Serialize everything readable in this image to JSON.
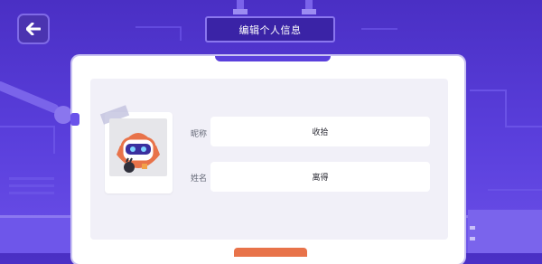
{
  "header": {
    "title": "编辑个人信息",
    "back_icon": "arrow-left-icon"
  },
  "profile": {
    "avatar_icon": "robot-avatar-icon",
    "nickname_label": "昵称",
    "nickname_value": "收拾",
    "name_label": "姓名",
    "name_value": "离得"
  },
  "colors": {
    "background": "#5a3fdc",
    "panel": "#ffffff",
    "inner_panel": "#f1f0f8",
    "accent": "#e8734a"
  }
}
